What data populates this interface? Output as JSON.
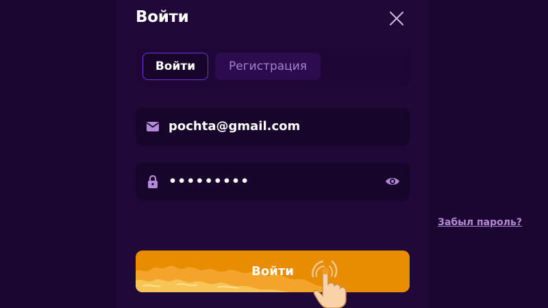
{
  "modal": {
    "title": "Войти",
    "close_icon": "close-icon"
  },
  "tabs": [
    {
      "label": "Войти",
      "active": true
    },
    {
      "label": "Регистрация",
      "active": false
    }
  ],
  "email_field": {
    "icon": "envelope-icon",
    "value": "pochta@gmail.com"
  },
  "password_field": {
    "icon": "lock-icon",
    "value": "•••••••••",
    "toggle_icon": "eye-icon"
  },
  "forgot_password": "Забыл пароль?",
  "submit": {
    "label": "Войти",
    "icon": "tap-hand-icon"
  },
  "colors": {
    "background": "#1b0631",
    "panel": "#200839",
    "accent_purple": "#7b31d9",
    "button_orange": "#e98d00",
    "link": "#b48ad6"
  }
}
